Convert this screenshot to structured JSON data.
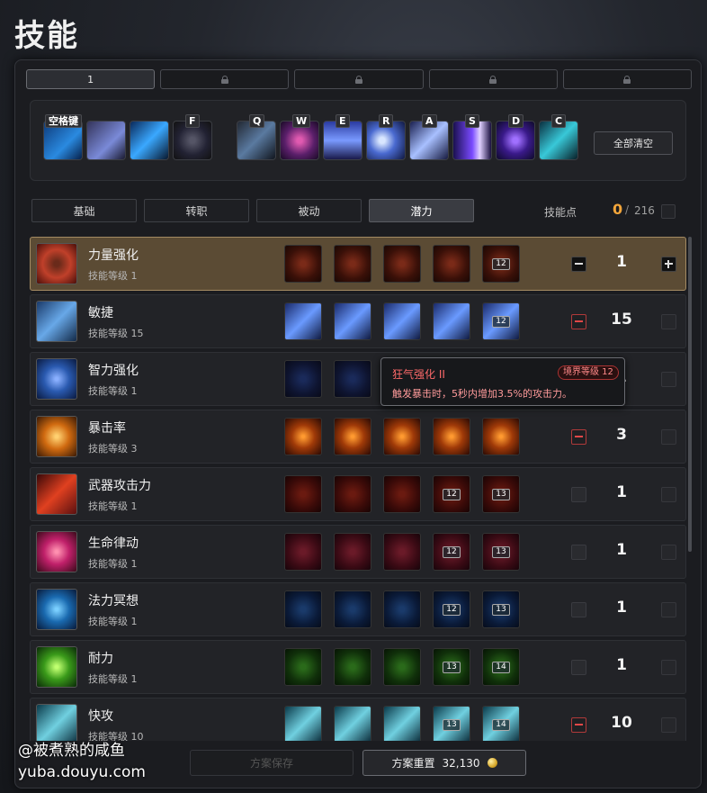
{
  "title": "技能",
  "loadout_tabs": [
    {
      "label": "1",
      "active": true
    },
    {
      "label": "",
      "locked": true
    },
    {
      "label": "",
      "locked": true
    },
    {
      "label": "",
      "locked": true
    },
    {
      "label": "",
      "locked": true
    }
  ],
  "hotbar": {
    "slots": [
      {
        "key": "空格键",
        "icon": "dash-silhouette-icon"
      },
      {
        "key": "",
        "icon": "figure-burst-icon"
      },
      {
        "key": "",
        "icon": "blue-claw-icon"
      },
      {
        "key": "F",
        "icon": "ring-sigil-icon"
      },
      {
        "key": "Q",
        "icon": "spear-thrust-icon"
      },
      {
        "key": "W",
        "icon": "heart-slash-icon"
      },
      {
        "key": "E",
        "icon": "blade-rain-icon"
      },
      {
        "key": "R",
        "icon": "crescent-moon-icon"
      },
      {
        "key": "A",
        "icon": "cross-slash-icon"
      },
      {
        "key": "S",
        "icon": "purple-beam-icon"
      },
      {
        "key": "D",
        "icon": "galaxy-orb-icon"
      },
      {
        "key": "C",
        "icon": "crystal-blade-icon"
      }
    ],
    "clear_all_label": "全部清空"
  },
  "category_tabs": [
    {
      "label": "基础",
      "active": false
    },
    {
      "label": "转职",
      "active": false
    },
    {
      "label": "被动",
      "active": false
    },
    {
      "label": "潜力",
      "active": true
    }
  ],
  "skill_points": {
    "label": "技能点",
    "current": "0",
    "separator": "/",
    "total": "216"
  },
  "skills": [
    {
      "name": "力量强化",
      "level": "技能等级 1",
      "value": "1",
      "icon": "fist-icon",
      "selected": true,
      "minus": "dark",
      "plus": "dark",
      "nodes": [
        {
          "badge": "",
          "dim": false
        },
        {
          "badge": "",
          "dim": false
        },
        {
          "badge": "",
          "dim": false
        },
        {
          "badge": "",
          "dim": false
        },
        {
          "badge": "12",
          "dim": false
        }
      ]
    },
    {
      "name": "敏捷",
      "level": "技能等级 15",
      "value": "15",
      "icon": "agility-icon",
      "selected": false,
      "minus": "enabled",
      "plus": "off",
      "nodes": [
        {
          "badge": "",
          "dim": false
        },
        {
          "badge": "",
          "dim": false
        },
        {
          "badge": "",
          "dim": false
        },
        {
          "badge": "",
          "dim": false
        },
        {
          "badge": "12",
          "dim": false
        }
      ]
    },
    {
      "name": "智力强化",
      "level": "技能等级 1",
      "value": "1",
      "icon": "intellect-icon",
      "selected": false,
      "minus": "off",
      "plus": "off",
      "nodes": [
        {
          "badge": "",
          "dim": false
        },
        {
          "badge": "",
          "dim": false
        },
        {
          "badge": "",
          "dim": false
        },
        {
          "badge": "",
          "dim": false
        },
        {
          "badge": "",
          "dim": false
        }
      ]
    },
    {
      "name": "暴击率",
      "level": "技能等级 3",
      "value": "3",
      "icon": "crit-punch-icon",
      "selected": false,
      "minus": "enabled",
      "plus": "off",
      "nodes": [
        {
          "badge": "",
          "dim": false
        },
        {
          "badge": "",
          "dim": false
        },
        {
          "badge": "",
          "dim": false
        },
        {
          "badge": "",
          "dim": false
        },
        {
          "badge": "",
          "dim": false
        }
      ]
    },
    {
      "name": "武器攻击力",
      "level": "技能等级 1",
      "value": "1",
      "icon": "weapon-strike-icon",
      "selected": false,
      "minus": "off",
      "plus": "off",
      "nodes": [
        {
          "badge": "",
          "dim": false
        },
        {
          "badge": "",
          "dim": false
        },
        {
          "badge": "",
          "dim": false
        },
        {
          "badge": "12",
          "dim": false
        },
        {
          "badge": "13",
          "dim": false
        }
      ]
    },
    {
      "name": "生命律动",
      "level": "技能等级 1",
      "value": "1",
      "icon": "heart-pulse-icon",
      "selected": false,
      "minus": "off",
      "plus": "off",
      "nodes": [
        {
          "badge": "",
          "dim": false
        },
        {
          "badge": "",
          "dim": false
        },
        {
          "badge": "",
          "dim": false
        },
        {
          "badge": "12",
          "dim": false
        },
        {
          "badge": "13",
          "dim": false
        }
      ]
    },
    {
      "name": "法力冥想",
      "level": "技能等级 1",
      "value": "1",
      "icon": "mana-meditate-icon",
      "selected": false,
      "minus": "off",
      "plus": "off",
      "nodes": [
        {
          "badge": "",
          "dim": false
        },
        {
          "badge": "",
          "dim": false
        },
        {
          "badge": "",
          "dim": false
        },
        {
          "badge": "12",
          "dim": false
        },
        {
          "badge": "13",
          "dim": false
        }
      ]
    },
    {
      "name": "耐力",
      "level": "技能等级 1",
      "value": "1",
      "icon": "stamina-icon",
      "selected": false,
      "minus": "off",
      "plus": "off",
      "nodes": [
        {
          "badge": "",
          "dim": false
        },
        {
          "badge": "",
          "dim": false
        },
        {
          "badge": "",
          "dim": false
        },
        {
          "badge": "13",
          "dim": false
        },
        {
          "badge": "14",
          "dim": false
        }
      ]
    },
    {
      "name": "快攻",
      "level": "技能等级 10",
      "value": "10",
      "icon": "quick-attack-icon",
      "selected": false,
      "minus": "enabled",
      "plus": "off",
      "nodes": [
        {
          "badge": "",
          "dim": false
        },
        {
          "badge": "",
          "dim": false
        },
        {
          "badge": "",
          "dim": false
        },
        {
          "badge": "13",
          "dim": false
        },
        {
          "badge": "14",
          "dim": false
        }
      ]
    }
  ],
  "tooltip": {
    "title": "狂气强化 II",
    "badge": "境界等级 12",
    "description": "触发暴击时，5秒内增加3.5%的攻击力。"
  },
  "footer": {
    "save_label": "方案保存",
    "reset_label": "方案重置",
    "reset_cost": "32,130"
  },
  "watermark": {
    "line1": "@被煮熟的咸鱼",
    "line2": "yuba.douyu.com"
  },
  "colors": {
    "accent_orange": "#f2a53a",
    "selected_row": "#5b4b34",
    "tooltip_red": "#ff6a6a"
  }
}
